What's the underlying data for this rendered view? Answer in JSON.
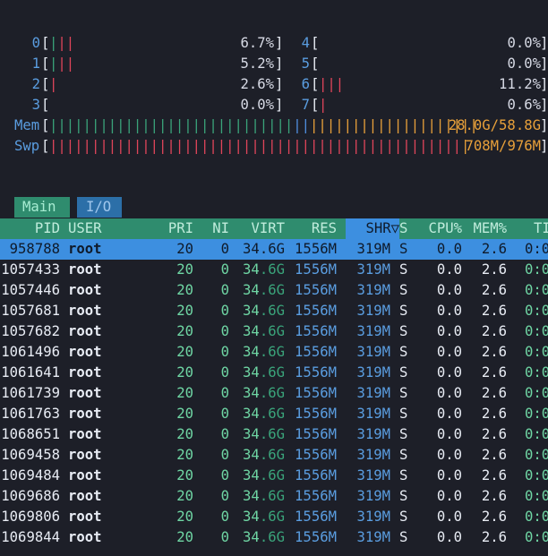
{
  "meters": {
    "cpus": [
      {
        "label": "0",
        "bars": "|||",
        "pct": "6.7%"
      },
      {
        "label": "1",
        "bars": "|||",
        "pct": "5.2%"
      },
      {
        "label": "2",
        "bars": "|",
        "pct": "2.6%"
      },
      {
        "label": "3",
        "bars": "",
        "pct": "0.0%"
      },
      {
        "label": "4",
        "bars": "",
        "pct": "0.0%"
      },
      {
        "label": "5",
        "bars": "",
        "pct": "0.0%"
      },
      {
        "label": "6",
        "bars": "|||",
        "pct": "11.2%"
      },
      {
        "label": "7",
        "bars": "|",
        "pct": "0.6%"
      }
    ],
    "mem": {
      "label": "Mem",
      "value": "28.0G/58.8G"
    },
    "swp": {
      "label": "Swp",
      "value": "708M/976M"
    }
  },
  "tabs": {
    "main": "Main",
    "io": "I/O"
  },
  "columns": {
    "pid": "PID",
    "user": "USER",
    "pri": "PRI",
    "ni": "NI",
    "virt": "VIRT",
    "res": "RES",
    "shr": "SHR▽",
    "s": "S",
    "cpu": "CPU%",
    "mem": "MEM%",
    "time": "TI"
  },
  "processes": [
    {
      "pid": "958788",
      "user": "root",
      "pri": "20",
      "ni": "0",
      "virt": "34.6G",
      "res": "1556M",
      "shr": "319M",
      "s": "S",
      "cpu": "0.0",
      "mem": "2.6",
      "time": "0:0",
      "selected": true
    },
    {
      "pid": "1057433",
      "user": "root",
      "pri": "20",
      "ni": "0",
      "virt": "34.6G",
      "res": "1556M",
      "shr": "319M",
      "s": "S",
      "cpu": "0.0",
      "mem": "2.6",
      "time": "0:0"
    },
    {
      "pid": "1057446",
      "user": "root",
      "pri": "20",
      "ni": "0",
      "virt": "34.6G",
      "res": "1556M",
      "shr": "319M",
      "s": "S",
      "cpu": "0.0",
      "mem": "2.6",
      "time": "0:0"
    },
    {
      "pid": "1057681",
      "user": "root",
      "pri": "20",
      "ni": "0",
      "virt": "34.6G",
      "res": "1556M",
      "shr": "319M",
      "s": "S",
      "cpu": "0.0",
      "mem": "2.6",
      "time": "0:0"
    },
    {
      "pid": "1057682",
      "user": "root",
      "pri": "20",
      "ni": "0",
      "virt": "34.6G",
      "res": "1556M",
      "shr": "319M",
      "s": "S",
      "cpu": "0.0",
      "mem": "2.6",
      "time": "0:0"
    },
    {
      "pid": "1061496",
      "user": "root",
      "pri": "20",
      "ni": "0",
      "virt": "34.6G",
      "res": "1556M",
      "shr": "319M",
      "s": "S",
      "cpu": "0.0",
      "mem": "2.6",
      "time": "0:0"
    },
    {
      "pid": "1061641",
      "user": "root",
      "pri": "20",
      "ni": "0",
      "virt": "34.6G",
      "res": "1556M",
      "shr": "319M",
      "s": "S",
      "cpu": "0.0",
      "mem": "2.6",
      "time": "0:0"
    },
    {
      "pid": "1061739",
      "user": "root",
      "pri": "20",
      "ni": "0",
      "virt": "34.6G",
      "res": "1556M",
      "shr": "319M",
      "s": "S",
      "cpu": "0.0",
      "mem": "2.6",
      "time": "0:0"
    },
    {
      "pid": "1061763",
      "user": "root",
      "pri": "20",
      "ni": "0",
      "virt": "34.6G",
      "res": "1556M",
      "shr": "319M",
      "s": "S",
      "cpu": "0.0",
      "mem": "2.6",
      "time": "0:0"
    },
    {
      "pid": "1068651",
      "user": "root",
      "pri": "20",
      "ni": "0",
      "virt": "34.6G",
      "res": "1556M",
      "shr": "319M",
      "s": "S",
      "cpu": "0.0",
      "mem": "2.6",
      "time": "0:0"
    },
    {
      "pid": "1069458",
      "user": "root",
      "pri": "20",
      "ni": "0",
      "virt": "34.6G",
      "res": "1556M",
      "shr": "319M",
      "s": "S",
      "cpu": "0.0",
      "mem": "2.6",
      "time": "0:0"
    },
    {
      "pid": "1069484",
      "user": "root",
      "pri": "20",
      "ni": "0",
      "virt": "34.6G",
      "res": "1556M",
      "shr": "319M",
      "s": "S",
      "cpu": "0.0",
      "mem": "2.6",
      "time": "0:0"
    },
    {
      "pid": "1069686",
      "user": "root",
      "pri": "20",
      "ni": "0",
      "virt": "34.6G",
      "res": "1556M",
      "shr": "319M",
      "s": "S",
      "cpu": "0.0",
      "mem": "2.6",
      "time": "0:0"
    },
    {
      "pid": "1069806",
      "user": "root",
      "pri": "20",
      "ni": "0",
      "virt": "34.6G",
      "res": "1556M",
      "shr": "319M",
      "s": "S",
      "cpu": "0.0",
      "mem": "2.6",
      "time": "0:0"
    },
    {
      "pid": "1069844",
      "user": "root",
      "pri": "20",
      "ni": "0",
      "virt": "34.6G",
      "res": "1556M",
      "shr": "319M",
      "s": "S",
      "cpu": "0.0",
      "mem": "2.6",
      "time": "0:0"
    }
  ]
}
